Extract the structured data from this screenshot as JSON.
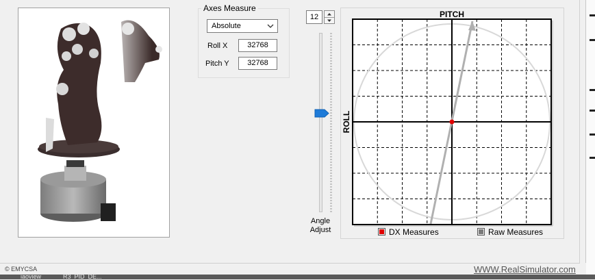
{
  "axes_group": {
    "title": "Axes Measure",
    "mode": {
      "selected": "Absolute",
      "icon": "chevron-down-icon"
    },
    "roll_x": {
      "label": "Roll X",
      "value": "32768"
    },
    "pitch_y": {
      "label": "Pitch Y",
      "value": "32768"
    }
  },
  "angle": {
    "value": "12",
    "label_line1": "Angle",
    "label_line2": "Adjust",
    "up_icon": "chevron-up-icon",
    "down_icon": "chevron-down-icon",
    "thumb_icon": "slider-thumb-icon",
    "slider_level": 0.55
  },
  "plot": {
    "top_label": "PITCH",
    "left_label": "ROLL",
    "grid_divisions": 8,
    "legend": {
      "dx": {
        "label": "DX Measures",
        "color": "#e00000"
      },
      "raw": {
        "label": "Raw Measures",
        "color": "#7a7a7a"
      }
    },
    "center_dot_color": "#e00000",
    "circle_color": "#d8d8d8",
    "arrow_color": "#b0b0b0"
  },
  "footer": {
    "copyright": "© EMYCSA",
    "website": "WWW.RealSimulator.com"
  },
  "taskbar": {
    "item1": "iaoview",
    "item2": "R3_PID_DE..."
  }
}
